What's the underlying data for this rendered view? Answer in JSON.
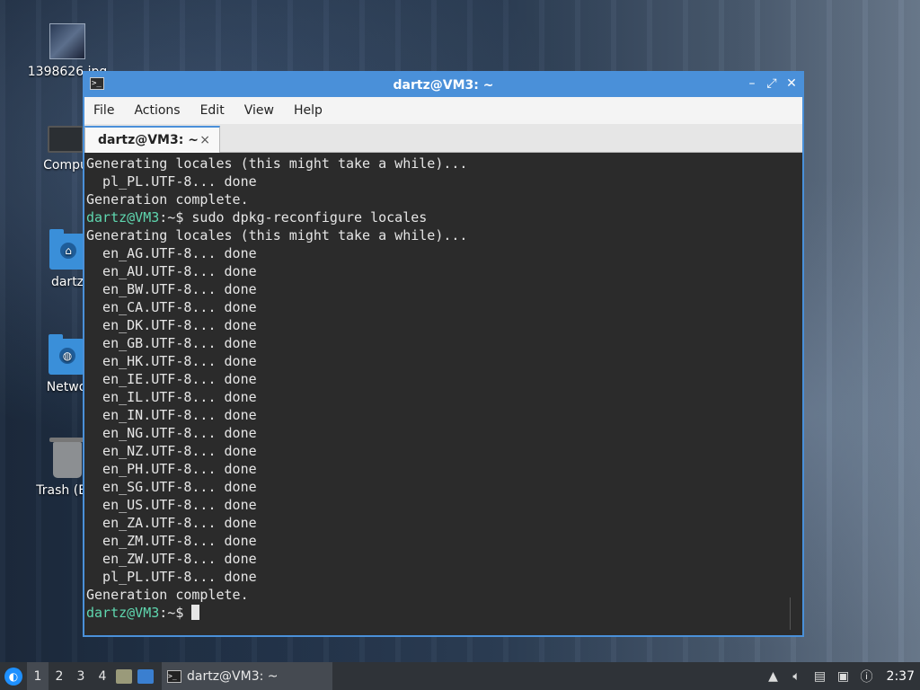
{
  "desktop": {
    "icons": [
      {
        "label": "1398626.jpg",
        "kind": "image"
      },
      {
        "label": "Compu",
        "kind": "computer"
      },
      {
        "label": "dartz",
        "kind": "home-folder"
      },
      {
        "label": "Netwo",
        "kind": "network-folder"
      },
      {
        "label": "Trash (Em",
        "kind": "trash"
      }
    ]
  },
  "window": {
    "title": "dartz@VM3: ~",
    "controls": {
      "minimize": "–",
      "maximize": "⤢",
      "close": "✕"
    },
    "menu": [
      "File",
      "Actions",
      "Edit",
      "View",
      "Help"
    ],
    "tab": {
      "label": "dartz@VM3: ~",
      "close": "×"
    }
  },
  "terminal": {
    "lines": [
      {
        "type": "text",
        "text": "Generating locales (this might take a while)..."
      },
      {
        "type": "text",
        "text": "  pl_PL.UTF-8... done"
      },
      {
        "type": "text",
        "text": "Generation complete."
      },
      {
        "type": "prompt",
        "user": "dartz@VM3",
        "path": ":~$",
        "cmd": " sudo dpkg-reconfigure locales"
      },
      {
        "type": "text",
        "text": "Generating locales (this might take a while)..."
      },
      {
        "type": "text",
        "text": "  en_AG.UTF-8... done"
      },
      {
        "type": "text",
        "text": "  en_AU.UTF-8... done"
      },
      {
        "type": "text",
        "text": "  en_BW.UTF-8... done"
      },
      {
        "type": "text",
        "text": "  en_CA.UTF-8... done"
      },
      {
        "type": "text",
        "text": "  en_DK.UTF-8... done"
      },
      {
        "type": "text",
        "text": "  en_GB.UTF-8... done"
      },
      {
        "type": "text",
        "text": "  en_HK.UTF-8... done"
      },
      {
        "type": "text",
        "text": "  en_IE.UTF-8... done"
      },
      {
        "type": "text",
        "text": "  en_IL.UTF-8... done"
      },
      {
        "type": "text",
        "text": "  en_IN.UTF-8... done"
      },
      {
        "type": "text",
        "text": "  en_NG.UTF-8... done"
      },
      {
        "type": "text",
        "text": "  en_NZ.UTF-8... done"
      },
      {
        "type": "text",
        "text": "  en_PH.UTF-8... done"
      },
      {
        "type": "text",
        "text": "  en_SG.UTF-8... done"
      },
      {
        "type": "text",
        "text": "  en_US.UTF-8... done"
      },
      {
        "type": "text",
        "text": "  en_ZA.UTF-8... done"
      },
      {
        "type": "text",
        "text": "  en_ZM.UTF-8... done"
      },
      {
        "type": "text",
        "text": "  en_ZW.UTF-8... done"
      },
      {
        "type": "text",
        "text": "  pl_PL.UTF-8... done"
      },
      {
        "type": "text",
        "text": "Generation complete."
      },
      {
        "type": "prompt",
        "user": "dartz@VM3",
        "path": ":~$",
        "cmd": " ",
        "cursor": true
      }
    ]
  },
  "taskbar": {
    "workspaces": [
      "1",
      "2",
      "3",
      "4"
    ],
    "active_workspace": "1",
    "task_label": "dartz@VM3: ~",
    "clock": "2:37"
  },
  "colors": {
    "accent": "#4a90d9",
    "prompt_user": "#5fd7af",
    "terminal_bg": "#2b2b2b"
  }
}
